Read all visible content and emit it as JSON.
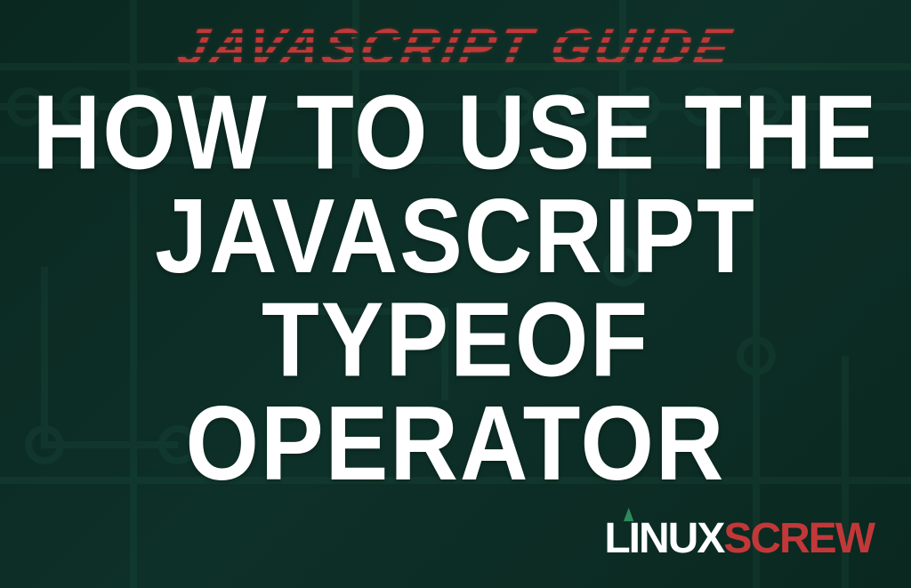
{
  "subtitle": "JAVASCRIPT GUIDE",
  "title_line1": "HOW TO USE THE",
  "title_line2": "JAVASCRIPT TYPEOF",
  "title_line3": "OPERATOR",
  "logo": {
    "part1": "LINUX",
    "part2": "SCREW"
  },
  "colors": {
    "background": "#0a2820",
    "accent_red": "#c23838",
    "text_white": "#ffffff",
    "circuit_green": "#1a4a38",
    "tree_green": "#2d8a5c"
  }
}
